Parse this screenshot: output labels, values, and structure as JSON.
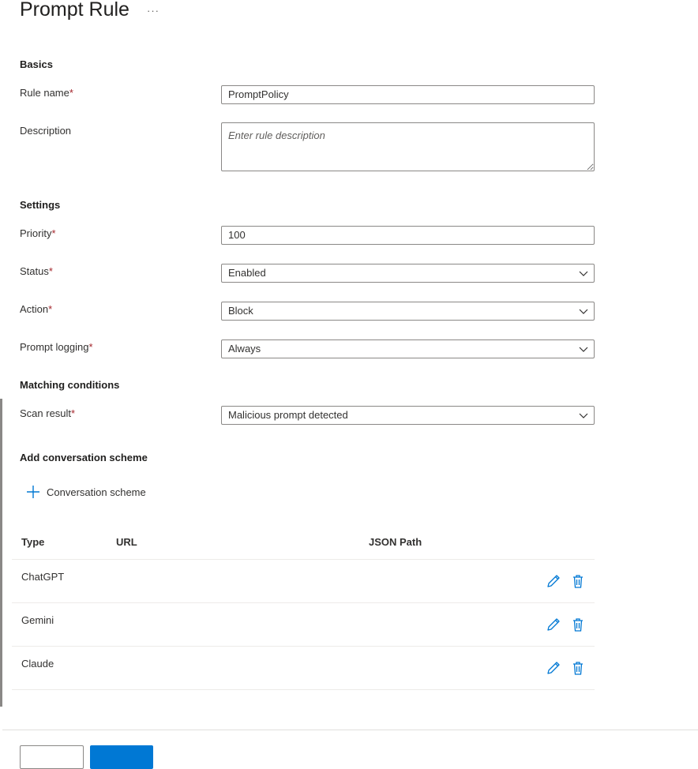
{
  "header": {
    "title": "Prompt Rule",
    "more": "···"
  },
  "basics": {
    "heading": "Basics",
    "rule_name_label": "Rule name",
    "rule_name_value": "PromptPolicy",
    "description_label": "Description",
    "description_placeholder": "Enter rule description"
  },
  "settings": {
    "heading": "Settings",
    "priority_label": "Priority",
    "priority_value": "100",
    "status_label": "Status",
    "status_value": "Enabled",
    "action_label": "Action",
    "action_value": "Block",
    "logging_label": "Prompt logging",
    "logging_value": "Always"
  },
  "matching": {
    "heading": "Matching conditions",
    "scan_label": "Scan result",
    "scan_value": "Malicious prompt detected"
  },
  "scheme": {
    "heading": "Add conversation scheme",
    "add_label": "Conversation scheme",
    "columns": {
      "type": "Type",
      "url": "URL",
      "json_path": "JSON Path"
    },
    "rows": [
      {
        "type": "ChatGPT",
        "url": "",
        "json_path": ""
      },
      {
        "type": "Gemini",
        "url": "",
        "json_path": ""
      },
      {
        "type": "Claude",
        "url": "",
        "json_path": ""
      }
    ]
  },
  "required_mark": "*",
  "colors": {
    "accent": "#0078d4",
    "required": "#a4262c",
    "text": "#323130"
  },
  "icons": {
    "add": "plus-icon",
    "edit": "pencil-icon",
    "delete": "trash-icon",
    "dropdown": "chevron-down-icon"
  }
}
